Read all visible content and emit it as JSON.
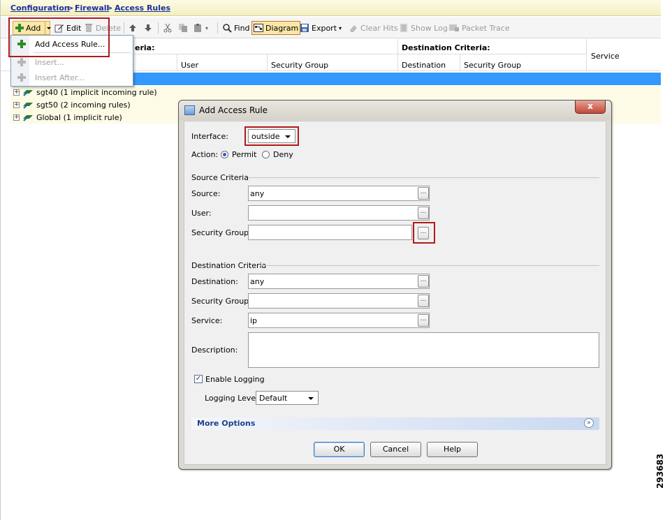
{
  "breadcrumb": [
    "Configuration",
    "Firewall",
    "Access Rules"
  ],
  "breadcrumb_sep": ">",
  "toolbar": {
    "add": "Add",
    "edit": "Edit",
    "delete": "Delete",
    "find": "Find",
    "diagram": "Diagram",
    "export": "Export",
    "clear_hits": "Clear Hits",
    "show_log": "Show Log",
    "packet_trace": "Packet Trace"
  },
  "add_menu": {
    "items": [
      "Add Access Rule...",
      "Insert...",
      "Insert After..."
    ]
  },
  "table": {
    "source_criteria_partial": "eria:",
    "destination_criteria": "Destination Criteria:",
    "service": "Service",
    "columns": [
      "User",
      "Security Group",
      "Destination",
      "Security Group"
    ],
    "rows": [
      "sgt40 (1 implicit incoming rule)",
      "sgt50 (2 incoming rules)",
      "Global (1 implicit rule)"
    ]
  },
  "dialog": {
    "title": "Add Access Rule",
    "close": "x",
    "interface_label": "Interface:",
    "interface_value": "outside",
    "action_label": "Action:",
    "permit": "Permit",
    "deny": "Deny",
    "source_section": "Source Criteria",
    "source_label": "Source:",
    "source_value": "any",
    "user_label": "User:",
    "user_value": "",
    "src_sg_label": "Security Group:",
    "src_sg_value": "",
    "dest_section": "Destination Criteria",
    "dest_label": "Destination:",
    "dest_value": "any",
    "dst_sg_label": "Security Group:",
    "dst_sg_value": "",
    "service_label": "Service:",
    "service_value": "ip",
    "description_label": "Description:",
    "description_value": "",
    "enable_logging": "Enable Logging",
    "logging_level_label": "Logging Level:",
    "logging_level_value": "Default",
    "more_options": "More Options",
    "ok": "OK",
    "cancel": "Cancel",
    "help": "Help",
    "ellipsis": "..."
  },
  "figure_number": "293683"
}
